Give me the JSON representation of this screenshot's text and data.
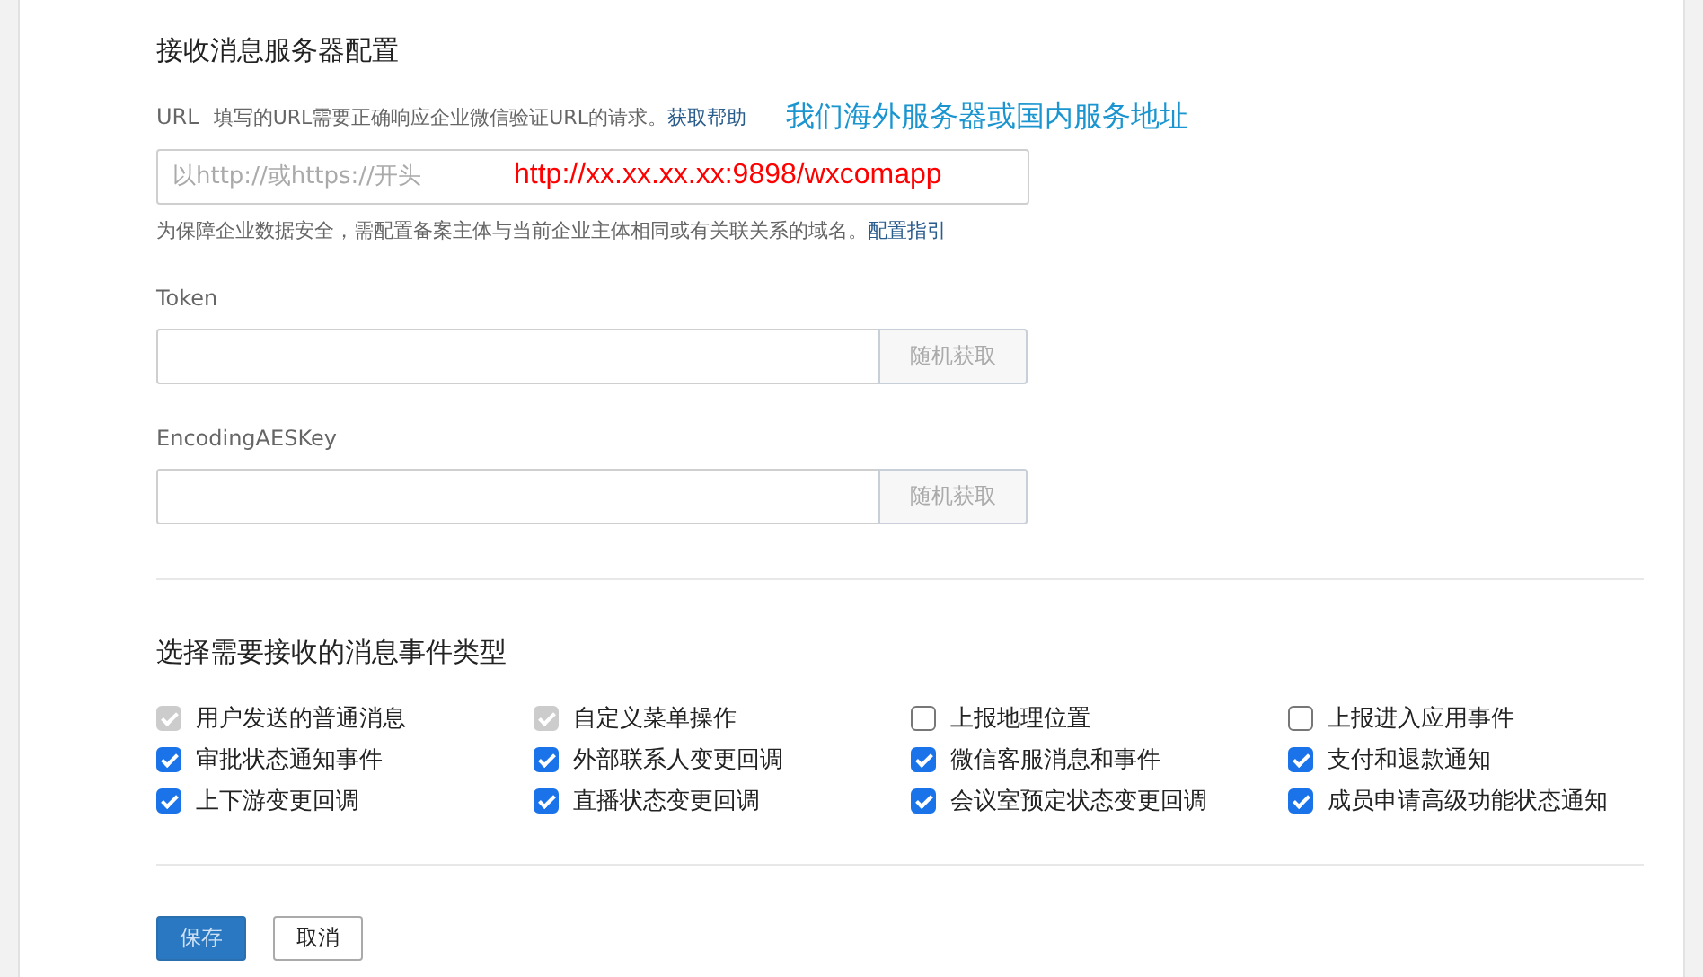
{
  "server_config": {
    "title": "接收消息服务器配置",
    "url": {
      "label": "URL",
      "hint": "填写的URL需要正确响应企业微信验证URL的请求。",
      "help_link": "获取帮助",
      "placeholder": "以http://或https://开头",
      "annotation_value": "http://xx.xx.xx.xx:9898/wxcomapp",
      "annotation_note": "我们海外服务器或国内服务地址"
    },
    "domain_note": "为保障企业数据安全，需配置备案主体与当前企业主体相同或有关联关系的域名。",
    "domain_link": "配置指引",
    "fields": [
      {
        "label": "Token",
        "button": "随机获取"
      },
      {
        "label": "EncodingAESKey",
        "button": "随机获取"
      }
    ]
  },
  "event_types": {
    "title": "选择需要接收的消息事件类型",
    "options": [
      {
        "label": "用户发送的普通消息",
        "checked": true,
        "disabled": true
      },
      {
        "label": "自定义菜单操作",
        "checked": true,
        "disabled": true
      },
      {
        "label": "上报地理位置",
        "checked": false,
        "disabled": false
      },
      {
        "label": "上报进入应用事件",
        "checked": false,
        "disabled": false
      },
      {
        "label": "审批状态通知事件",
        "checked": true,
        "disabled": false
      },
      {
        "label": "外部联系人变更回调",
        "checked": true,
        "disabled": false
      },
      {
        "label": "微信客服消息和事件",
        "checked": true,
        "disabled": false
      },
      {
        "label": "支付和退款通知",
        "checked": true,
        "disabled": false
      },
      {
        "label": "上下游变更回调",
        "checked": true,
        "disabled": false
      },
      {
        "label": "直播状态变更回调",
        "checked": true,
        "disabled": false
      },
      {
        "label": "会议室预定状态变更回调",
        "checked": true,
        "disabled": false
      },
      {
        "label": "成员申请高级功能状态通知",
        "checked": true,
        "disabled": false
      }
    ]
  },
  "buttons": [
    {
      "label": "保存",
      "kind": "primary"
    },
    {
      "label": "取消",
      "kind": "secondary"
    }
  ]
}
